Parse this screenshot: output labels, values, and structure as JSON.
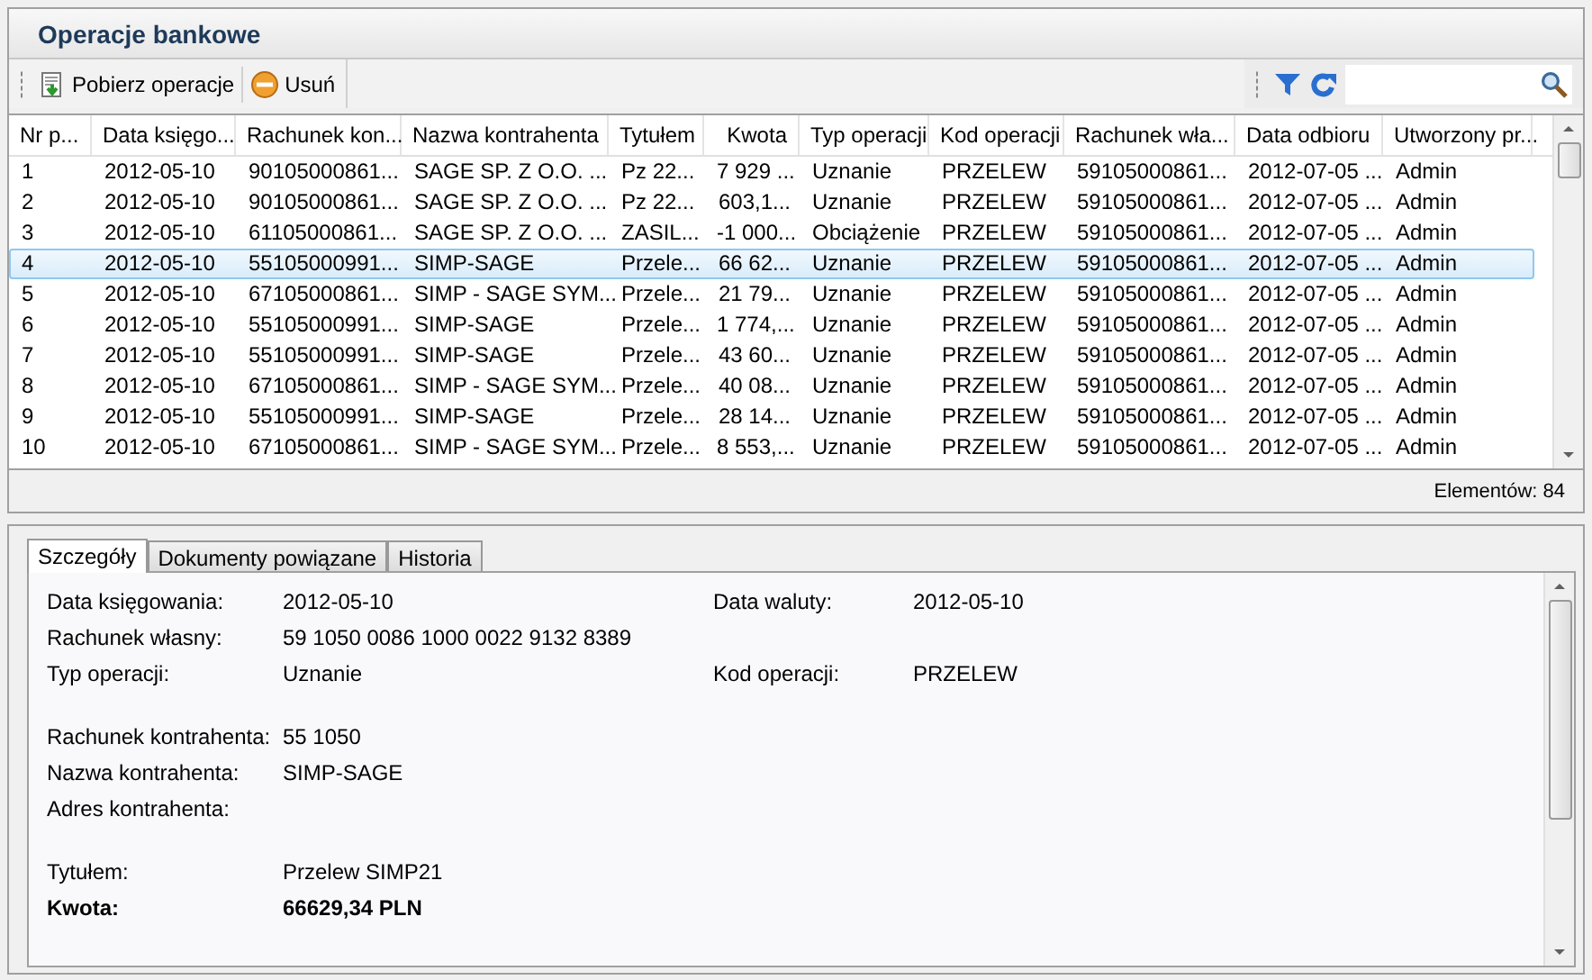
{
  "window": {
    "title": "Operacje bankowe"
  },
  "toolbar": {
    "buttons": [
      {
        "label": "Pobierz operacje",
        "kind": "download"
      },
      {
        "label": "Usuń",
        "kind": "delete"
      }
    ]
  },
  "table": {
    "columns": [
      {
        "label": "Nr p..."
      },
      {
        "label": "Data księgo..."
      },
      {
        "label": "Rachunek kon..."
      },
      {
        "label": "Nazwa kontrahenta"
      },
      {
        "label": "Tytułem"
      },
      {
        "label": "Kwota",
        "numeric": true
      },
      {
        "label": "Typ operacji"
      },
      {
        "label": "Kod operacji"
      },
      {
        "label": "Rachunek wła..."
      },
      {
        "label": "Data odbioru"
      },
      {
        "label": "Utworzony pr..."
      }
    ],
    "rows": [
      {
        "selected": false,
        "cells": [
          "1",
          "2012-05-10",
          "90105000861...",
          "SAGE SP. Z O.O. ...",
          "Pz 22...",
          "7 929 ...",
          "Uznanie",
          "PRZELEW",
          "59105000861...",
          "2012-07-05 ...",
          "Admin"
        ]
      },
      {
        "selected": false,
        "cells": [
          "2",
          "2012-05-10",
          "90105000861...",
          "SAGE SP. Z O.O. ...",
          "Pz 22...",
          "603,1...",
          "Uznanie",
          "PRZELEW",
          "59105000861...",
          "2012-07-05 ...",
          "Admin"
        ]
      },
      {
        "selected": false,
        "cells": [
          "3",
          "2012-05-10",
          "61105000861...",
          "SAGE SP. Z O.O. ...",
          "ZASIL...",
          "-1 000...",
          "Obciążenie",
          "PRZELEW",
          "59105000861...",
          "2012-07-05 ...",
          "Admin"
        ]
      },
      {
        "selected": true,
        "cells": [
          "4",
          "2012-05-10",
          "55105000991...",
          "SIMP-SAGE",
          "Przele...",
          "66 62...",
          "Uznanie",
          "PRZELEW",
          "59105000861...",
          "2012-07-05 ...",
          "Admin"
        ]
      },
      {
        "selected": false,
        "cells": [
          "5",
          "2012-05-10",
          "67105000861...",
          "SIMP - SAGE SYM...",
          "Przele...",
          "21 79...",
          "Uznanie",
          "PRZELEW",
          "59105000861...",
          "2012-07-05 ...",
          "Admin"
        ]
      },
      {
        "selected": false,
        "cells": [
          "6",
          "2012-05-10",
          "55105000991...",
          "SIMP-SAGE",
          "Przele...",
          "1 774,...",
          "Uznanie",
          "PRZELEW",
          "59105000861...",
          "2012-07-05 ...",
          "Admin"
        ]
      },
      {
        "selected": false,
        "cells": [
          "7",
          "2012-05-10",
          "55105000991...",
          "SIMP-SAGE",
          "Przele...",
          "43 60...",
          "Uznanie",
          "PRZELEW",
          "59105000861...",
          "2012-07-05 ...",
          "Admin"
        ]
      },
      {
        "selected": false,
        "cells": [
          "8",
          "2012-05-10",
          "67105000861...",
          "SIMP - SAGE SYM...",
          "Przele...",
          "40 08...",
          "Uznanie",
          "PRZELEW",
          "59105000861...",
          "2012-07-05 ...",
          "Admin"
        ]
      },
      {
        "selected": false,
        "cells": [
          "9",
          "2012-05-10",
          "55105000991...",
          "SIMP-SAGE",
          "Przele...",
          "28 14...",
          "Uznanie",
          "PRZELEW",
          "59105000861...",
          "2012-07-05 ...",
          "Admin"
        ]
      },
      {
        "selected": false,
        "cells": [
          "10",
          "2012-05-10",
          "67105000861...",
          "SIMP - SAGE SYM...",
          "Przele...",
          "8 553,...",
          "Uznanie",
          "PRZELEW",
          "59105000861...",
          "2012-07-05 ...",
          "Admin"
        ]
      }
    ]
  },
  "status_bar": {
    "count": "Elementów: 84"
  },
  "tabs": [
    {
      "label": "Szczegóły",
      "selected": true
    },
    {
      "label": "Dokumenty powiązane",
      "selected": false
    },
    {
      "label": "Historia",
      "selected": false
    }
  ],
  "details": {
    "groups": [
      [
        {
          "fields": [
            {
              "label": "Data księgowania:",
              "value": "2012-05-10"
            },
            {
              "label": "Data waluty:",
              "value": "2012-05-10"
            }
          ]
        },
        {
          "fields": [
            {
              "label": "Rachunek własny:",
              "value": "59 1050 0086 1000 0022 9132 8389"
            }
          ]
        },
        {
          "fields": [
            {
              "label": "Typ operacji:",
              "value": "Uznanie"
            },
            {
              "label": "Kod operacji:",
              "value": "PRZELEW"
            }
          ]
        }
      ],
      [
        {
          "fields": [
            {
              "label": "Rachunek kontrahenta:",
              "value": "55 1050"
            }
          ]
        },
        {
          "fields": [
            {
              "label": "Nazwa kontrahenta:",
              "value": "SIMP-SAGE"
            }
          ]
        },
        {
          "fields": [
            {
              "label": "Adres kontrahenta:"
            }
          ]
        }
      ],
      [
        {
          "fields": [
            {
              "label": "Tytułem:",
              "value": "Przelew SIMP21"
            }
          ]
        },
        {
          "bold": true,
          "fields": [
            {
              "label": "Kwota:",
              "value": "66629,34 PLN"
            }
          ]
        }
      ]
    ]
  }
}
